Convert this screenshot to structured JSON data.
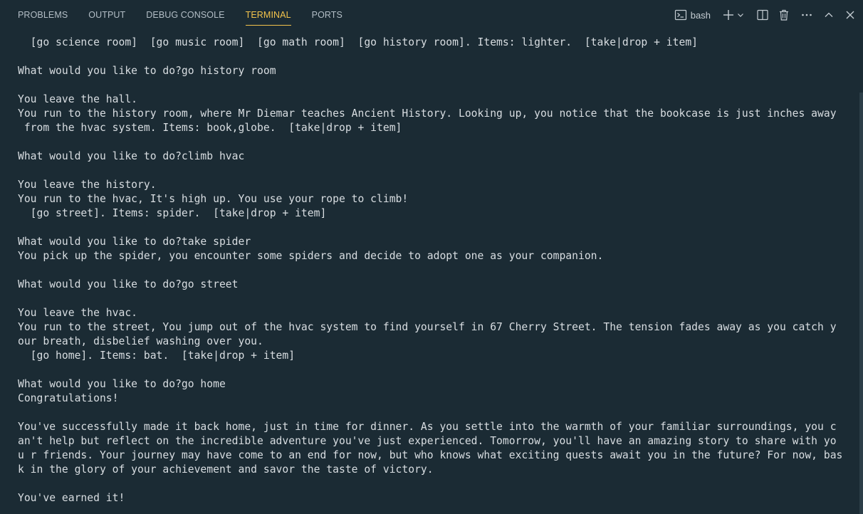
{
  "tabs": [
    {
      "label": "PROBLEMS",
      "active": false
    },
    {
      "label": "OUTPUT",
      "active": false
    },
    {
      "label": "DEBUG CONSOLE",
      "active": false
    },
    {
      "label": "TERMINAL",
      "active": true
    },
    {
      "label": "PORTS",
      "active": false
    }
  ],
  "toolbar": {
    "shell_label": "bash",
    "icons": [
      "terminal-icon",
      "plus-icon",
      "chevron-down-icon",
      "split-icon",
      "trash-icon",
      "more-icon",
      "chevron-up-icon",
      "close-icon"
    ]
  },
  "colors": {
    "background": "#1b2b34",
    "active_tab": "#f3c34c",
    "text": "#d8dde1"
  },
  "terminal": {
    "lines": [
      "  [go science room]  [go music room]  [go math room]  [go history room]. Items: lighter.  [take|drop + item]",
      "",
      "What would you like to do?go history room",
      "",
      "You leave the hall.",
      "You run to the history room, where Mr Diemar teaches Ancient History. Looking up, you notice that the bookcase is just inches away",
      " from the hvac system. Items: book,globe.  [take|drop + item]",
      "",
      "What would you like to do?climb hvac",
      "",
      "You leave the history.",
      "You run to the hvac, It's high up. You use your rope to climb!",
      "  [go street]. Items: spider.  [take|drop + item]",
      "",
      "What would you like to do?take spider",
      "You pick up the spider, you encounter some spiders and decide to adopt one as your companion.",
      "",
      "What would you like to do?go street",
      "",
      "You leave the hvac.",
      "You run to the street, You jump out of the hvac system to find yourself in 67 Cherry Street. The tension fades away as you catch y",
      "our breath, disbelief washing over you.",
      "  [go home]. Items: bat.  [take|drop + item]",
      "",
      "What would you like to do?go home",
      "Congratulations!",
      "",
      "You've successfully made it back home, just in time for dinner. As you settle into the warmth of your familiar surroundings, you c",
      "an't help but reflect on the incredible adventure you've just experienced. Tomorrow, you'll have an amazing story to share with yo",
      "u r friends. Your journey may have come to an end for now, but who knows what exciting quests await you in the future? For now, bas",
      "k in the glory of your achievement and savor the taste of victory.",
      "",
      "You've earned it!"
    ]
  }
}
